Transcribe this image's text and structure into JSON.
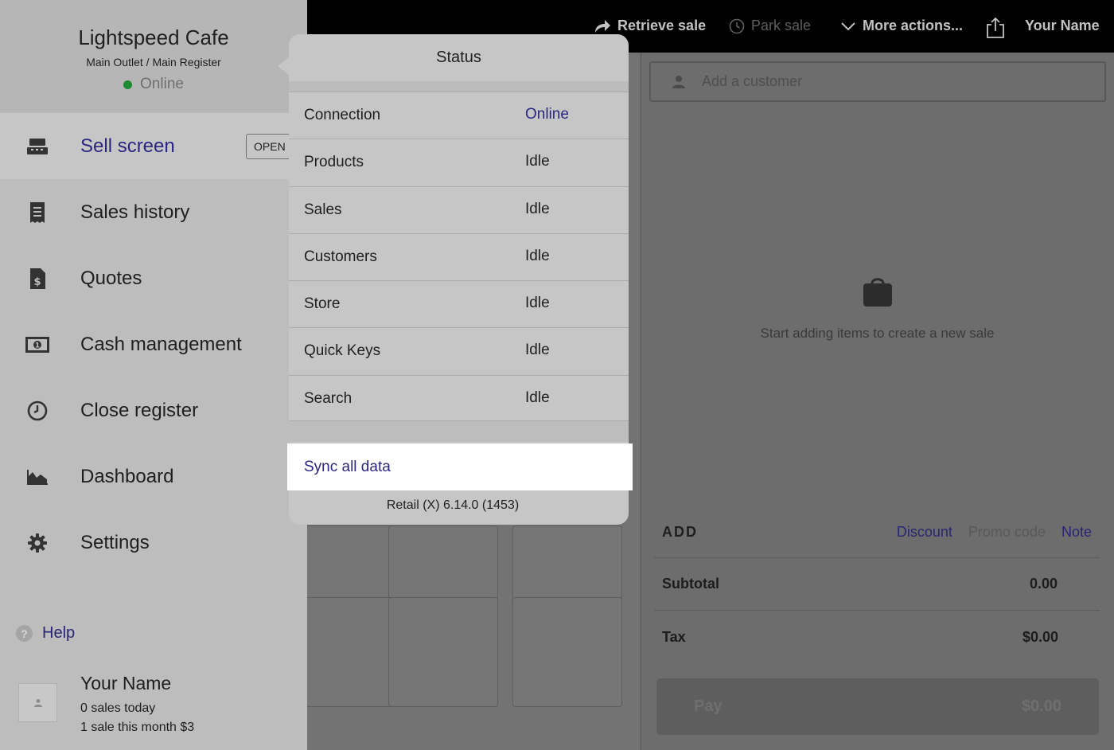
{
  "topbar": {
    "retrieve_sale": "Retrieve sale",
    "park_sale": "Park sale",
    "more_actions": "More actions...",
    "user": "Your Name"
  },
  "sidebar": {
    "store_name": "Lightspeed Cafe",
    "outlet": "Main Outlet / Main Register",
    "status": "Online",
    "status_color": "#1e8a31",
    "open_badge": "OPEN",
    "items": [
      {
        "label": "Sell screen",
        "icon": "register-icon",
        "active": true
      },
      {
        "label": "Sales history",
        "icon": "receipt-icon"
      },
      {
        "label": "Quotes",
        "icon": "quote-document-icon"
      },
      {
        "label": "Cash management",
        "icon": "banknote-icon"
      },
      {
        "label": "Close register",
        "icon": "clock-icon"
      },
      {
        "label": "Dashboard",
        "icon": "area-chart-icon"
      },
      {
        "label": "Settings",
        "icon": "gear-icon"
      }
    ],
    "help": "Help",
    "user": {
      "name": "Your Name",
      "sales_today": "0 sales today",
      "sales_month": "1 sale this month $3"
    }
  },
  "popover": {
    "title": "Status",
    "rows": [
      {
        "label": "Connection",
        "value": "Online"
      },
      {
        "label": "Products",
        "value": "Idle"
      },
      {
        "label": "Sales",
        "value": "Idle"
      },
      {
        "label": "Customers",
        "value": "Idle"
      },
      {
        "label": "Store",
        "value": "Idle"
      },
      {
        "label": "Quick Keys",
        "value": "Idle"
      },
      {
        "label": "Search",
        "value": "Idle"
      }
    ],
    "sync_label": "Sync all data",
    "version": "Retail (X) 6.14.0 (1453)"
  },
  "sale": {
    "customer_placeholder": "Add a customer",
    "empty_message": "Start adding items to create a new sale",
    "add_label": "ADD",
    "discount": "Discount",
    "promo_code": "Promo code",
    "note": "Note",
    "subtotal_label": "Subtotal",
    "subtotal_value": "0.00",
    "tax_label": "Tax",
    "tax_value": "$0.00",
    "pay_label": "Pay",
    "pay_amount": "$0.00"
  },
  "colors": {
    "accent": "#2a2580",
    "online_dot": "#1e8a31"
  }
}
